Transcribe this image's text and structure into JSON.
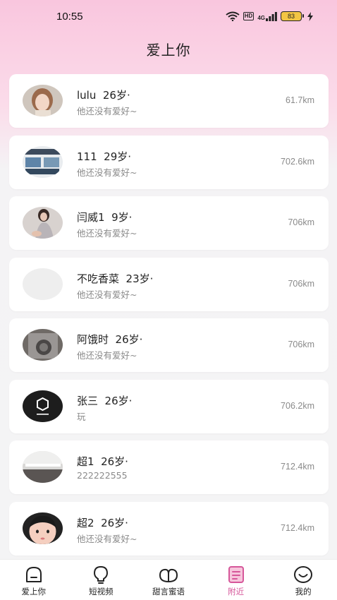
{
  "status_bar": {
    "time": "10:55",
    "hd_label": "HD",
    "network_label": "4G",
    "battery": "83",
    "icons": [
      "wifi-icon",
      "hd-icon",
      "signal-icon",
      "battery-icon",
      "charging-icon"
    ]
  },
  "header": {
    "title": "爱上你"
  },
  "users": [
    {
      "name": "lulu  26岁·",
      "hobby": "他还没有爱好~",
      "distance": "61.7km",
      "avatar": "photo-girl"
    },
    {
      "name": "111  29岁·",
      "hobby": "他还没有爱好~",
      "distance": "702.6km",
      "avatar": "photo-screen"
    },
    {
      "name": "闫威1  9岁·",
      "hobby": "他还没有爱好~",
      "distance": "706km",
      "avatar": "photo-woman"
    },
    {
      "name": "不吃香菜  23岁·",
      "hobby": "他还没有爱好~",
      "distance": "706km",
      "avatar": "placeholder-gray"
    },
    {
      "name": "阿饿时  26岁·",
      "hobby": "他还没有爱好~",
      "distance": "706km",
      "avatar": "photo-machine"
    },
    {
      "name": "张三  26岁·",
      "hobby": "玩",
      "distance": "706.2km",
      "avatar": "logo-dark"
    },
    {
      "name": "超1  26岁·",
      "hobby": "222222555",
      "distance": "712.4km",
      "avatar": "photo-ceiling"
    },
    {
      "name": "超2  26岁·",
      "hobby": "他还没有爱好~",
      "distance": "712.4km",
      "avatar": "cartoon-face"
    }
  ],
  "tabs": [
    {
      "label": "爱上你",
      "icon": "home-icon",
      "active": false
    },
    {
      "label": "短视频",
      "icon": "bulb-icon",
      "active": false
    },
    {
      "label": "甜言蜜语",
      "icon": "leaf-icon",
      "active": false
    },
    {
      "label": "附近",
      "icon": "document-icon",
      "active": true
    },
    {
      "label": "我的",
      "icon": "smile-icon",
      "active": false
    }
  ],
  "colors": {
    "accent": "#d6579a",
    "header_pink": "#f9c6de",
    "text_secondary": "#8a8a8a"
  }
}
